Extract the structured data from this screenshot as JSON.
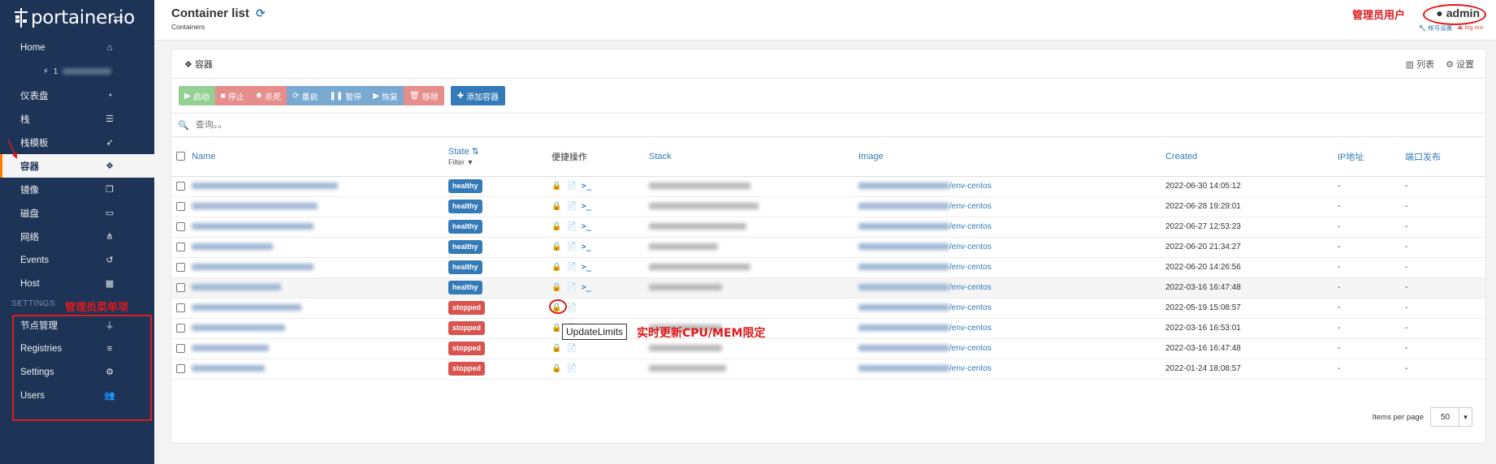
{
  "brand": {
    "name": "portainer.io"
  },
  "sidebar": {
    "items": [
      {
        "label": "Home",
        "icon": "home-icon"
      },
      {
        "label": "仪表盘",
        "icon": "dashboard-icon"
      },
      {
        "label": "栈",
        "icon": "list-icon"
      },
      {
        "label": "栈模板",
        "icon": "rocket-icon"
      },
      {
        "label": "容器",
        "icon": "cubes-icon",
        "active": true
      },
      {
        "label": "镜像",
        "icon": "clone-icon"
      },
      {
        "label": "磁盘",
        "icon": "hdd-icon"
      },
      {
        "label": "网络",
        "icon": "sitemap-icon"
      },
      {
        "label": "Events",
        "icon": "history-icon"
      },
      {
        "label": "Host",
        "icon": "th-icon"
      }
    ],
    "endpoint_prefix": "1",
    "settings_title": "SETTINGS",
    "settings_items": [
      {
        "label": "节点管理",
        "icon": "plug-icon"
      },
      {
        "label": "Registries",
        "icon": "database-icon"
      },
      {
        "label": "Settings",
        "icon": "cogs-icon"
      },
      {
        "label": "Users",
        "icon": "users-icon"
      }
    ]
  },
  "header": {
    "title": "Container list",
    "breadcrumb": "Containers",
    "username": "admin",
    "account_settings": "帐号设置",
    "logout": "log out"
  },
  "panel": {
    "title": "容器",
    "columns_label": "列表",
    "settings_label": "设置"
  },
  "toolbar": {
    "start": "启动",
    "stop": "停止",
    "kill": "杀死",
    "restart": "重启",
    "pause": "暂停",
    "resume": "恢复",
    "remove": "移除",
    "add": "添加容器"
  },
  "search": {
    "placeholder": "查询。。"
  },
  "table": {
    "headers": {
      "name": "Name",
      "state": "State",
      "filter": "Filter",
      "quick_actions": "便捷操作",
      "stack": "Stack",
      "image": "Image",
      "created": "Created",
      "ip": "IP地址",
      "ports": "端口发布"
    },
    "rows": [
      {
        "state": "healthy",
        "image_suffix": "/env-centos",
        "created": "2022-06-30 14:05:12",
        "ip": "-",
        "ports": "-",
        "actions": 3
      },
      {
        "state": "healthy",
        "image_suffix": "/env-centos",
        "created": "2022-06-28 19:29:01",
        "ip": "-",
        "ports": "-",
        "actions": 3
      },
      {
        "state": "healthy",
        "image_suffix": "/env-centos",
        "created": "2022-06-27 12:53:23",
        "ip": "-",
        "ports": "-",
        "actions": 3
      },
      {
        "state": "healthy",
        "image_suffix": "/env-centos",
        "created": "2022-06-20 21:34:27",
        "ip": "-",
        "ports": "-",
        "actions": 3
      },
      {
        "state": "healthy",
        "image_suffix": "/env-centos",
        "created": "2022-06-20 14:26:56",
        "ip": "-",
        "ports": "-",
        "actions": 3
      },
      {
        "state": "healthy",
        "image_suffix": "/env-centos",
        "created": "2022-03-16 16:47:48",
        "ip": "-",
        "ports": "-",
        "actions": 3
      },
      {
        "state": "stopped",
        "image_suffix": "/env-centos",
        "created": "2022-05-19 15:08:57",
        "ip": "-",
        "ports": "-",
        "actions": 2
      },
      {
        "state": "stopped",
        "image_suffix": "/env-centos",
        "created": "2022-03-16 16:53:01",
        "ip": "-",
        "ports": "-",
        "actions": 2
      },
      {
        "state": "stopped",
        "image_suffix": "/env-centos",
        "created": "2022-03-16 16:47:48",
        "ip": "-",
        "ports": "-",
        "actions": 2
      },
      {
        "state": "stopped",
        "image_suffix": "/env-centos",
        "created": "2022-01-24 18:08:57",
        "ip": "-",
        "ports": "-",
        "actions": 2
      }
    ]
  },
  "pagination": {
    "label": "Items per page",
    "value": "50"
  },
  "annotations": {
    "admin_user": "管理员用户",
    "admin_menu": "管理员菜单项",
    "tooltip": "UpdateLimits",
    "tooltip_note": "实时更新CPU/MEM限定"
  },
  "colors": {
    "sidebar": "#1d3457",
    "accent": "#337ab7",
    "healthy": "#337ab7",
    "stopped": "#d9534f",
    "annotation": "#e0191b"
  }
}
